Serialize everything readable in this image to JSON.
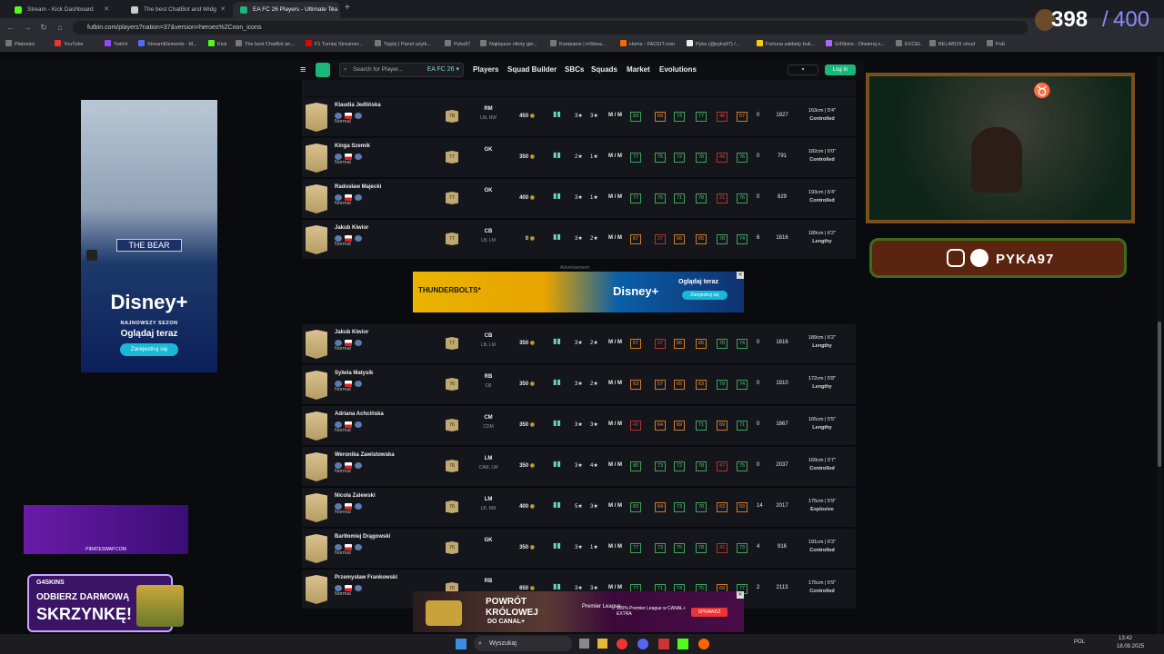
{
  "browser": {
    "tabs": [
      {
        "label": "Stream - Kick Dashboard",
        "color": "#53fc18"
      },
      {
        "label": "The best ChatBot and Widg",
        "color": "#cccccc"
      },
      {
        "label": "EA FC 26 Players - Ultimate Tea",
        "color": "#1ab67a"
      }
    ],
    "url": "futbin.com/players?nation=37&version=heroes%2Cnon_icons",
    "bookmarks": [
      "Płatności",
      "YouTube",
      "Twitch",
      "StreamElements - M...",
      "Kick",
      "The best ChatBot an...",
      "F1 Turniej Streamer...",
      "Tipply | Panel użytk...",
      "Pyka97",
      "Najlepsze oferty gie...",
      "Kampanie | inStrea...",
      "Home - FACEIT.com",
      "Pyka (@pyka97) /...",
      "Fortuna zakłady buk...",
      "G4Skins - Otwieraj s...",
      "EXCEL",
      "BELABOX cloud",
      "PoE"
    ]
  },
  "site": {
    "search_placeholder": "Search for Player...",
    "game_version": "EA FC 26",
    "nav": [
      "Players",
      "Squad Builder",
      "SBCs",
      "Squads",
      "Market",
      "Evolutions"
    ],
    "login": "Log In"
  },
  "ad_label": "Advertisement",
  "players_top": [
    {
      "name": "Klaudia Jedlińska",
      "version": "Normal",
      "rating": "78",
      "pos": "RM",
      "alt": "LM, RW",
      "price": "450",
      "sm": "3★",
      "wf": "3★",
      "wr": "M / M",
      "stats": [
        [
          "83",
          "g"
        ],
        [
          "69",
          "o"
        ],
        [
          "73",
          "g"
        ],
        [
          "77",
          "g"
        ],
        [
          "48",
          "r"
        ],
        [
          "57",
          "o"
        ]
      ],
      "bs": "0",
      "total": "1927",
      "height": "163cm | 5'4\"",
      "body": "Controlled"
    },
    {
      "name": "Kinga Szemik",
      "version": "Normal",
      "rating": "77",
      "pos": "GK",
      "alt": "",
      "price": "350",
      "sm": "2★",
      "wf": "1★",
      "wr": "M / M",
      "stats": [
        [
          "77",
          "g"
        ],
        [
          "75",
          "g"
        ],
        [
          "72",
          "g"
        ],
        [
          "78",
          "g"
        ],
        [
          "49",
          "r"
        ],
        [
          "76",
          "g"
        ]
      ],
      "bs": "0",
      "total": "791",
      "height": "182cm | 6'0\"",
      "body": "Controlled"
    },
    {
      "name": "Radosław Majecki",
      "version": "Normal",
      "rating": "77",
      "pos": "GK",
      "alt": "",
      "price": "400",
      "sm": "3★",
      "wf": "1★",
      "wr": "M / M",
      "stats": [
        [
          "77",
          "g"
        ],
        [
          "75",
          "g"
        ],
        [
          "71",
          "g"
        ],
        [
          "78",
          "g"
        ],
        [
          "31",
          "r"
        ],
        [
          "76",
          "g"
        ]
      ],
      "bs": "0",
      "total": "829",
      "height": "193cm | 6'4\"",
      "body": "Controlled"
    },
    {
      "name": "Jakub Kiwior",
      "version": "Normal",
      "rating": "77",
      "pos": "CB",
      "alt": "LB, LM",
      "price": "0",
      "sm": "3★",
      "wf": "2★",
      "wr": "M / M",
      "stats": [
        [
          "67",
          "o"
        ],
        [
          "37",
          "r"
        ],
        [
          "66",
          "o"
        ],
        [
          "65",
          "o"
        ],
        [
          "78",
          "g"
        ],
        [
          "74",
          "g"
        ]
      ],
      "bs": "6",
      "total": "1816",
      "height": "189cm | 6'2\"",
      "body": "Lengthy"
    }
  ],
  "players_bottom": [
    {
      "name": "Jakub Kiwior",
      "version": "Normal",
      "rating": "77",
      "pos": "CB",
      "alt": "LB, LM",
      "price": "350",
      "sm": "3★",
      "wf": "2★",
      "wr": "M / M",
      "stats": [
        [
          "67",
          "o"
        ],
        [
          "37",
          "r"
        ],
        [
          "66",
          "o"
        ],
        [
          "65",
          "o"
        ],
        [
          "78",
          "g"
        ],
        [
          "74",
          "g"
        ]
      ],
      "bs": "0",
      "total": "1816",
      "height": "189cm | 6'2\"",
      "body": "Lengthy"
    },
    {
      "name": "Sylwia Matysik",
      "version": "Normal",
      "rating": "76",
      "pos": "RB",
      "alt": "CB",
      "price": "350",
      "sm": "3★",
      "wf": "2★",
      "wr": "M / M",
      "stats": [
        [
          "63",
          "o"
        ],
        [
          "57",
          "o"
        ],
        [
          "65",
          "o"
        ],
        [
          "63",
          "o"
        ],
        [
          "79",
          "g"
        ],
        [
          "74",
          "g"
        ]
      ],
      "bs": "0",
      "total": "1910",
      "height": "172cm | 5'8\"",
      "body": "Lengthy"
    },
    {
      "name": "Adriana Achcińska",
      "version": "Normal",
      "rating": "76",
      "pos": "CM",
      "alt": "CDM",
      "price": "350",
      "sm": "3★",
      "wf": "3★",
      "wr": "M / M",
      "stats": [
        [
          "41",
          "r"
        ],
        [
          "64",
          "o"
        ],
        [
          "69",
          "o"
        ],
        [
          "71",
          "g"
        ],
        [
          "69",
          "o"
        ],
        [
          "71",
          "g"
        ]
      ],
      "bs": "0",
      "total": "1867",
      "height": "165cm | 5'5\"",
      "body": "Lengthy"
    },
    {
      "name": "Weronika Zawistowska",
      "version": "Normal",
      "rating": "76",
      "pos": "LM",
      "alt": "CAM, LW",
      "price": "350",
      "sm": "3★",
      "wf": "4★",
      "wr": "M / M",
      "stats": [
        [
          "80",
          "g"
        ],
        [
          "73",
          "g"
        ],
        [
          "72",
          "g"
        ],
        [
          "78",
          "g"
        ],
        [
          "47",
          "r"
        ],
        [
          "75",
          "g"
        ]
      ],
      "bs": "0",
      "total": "2037",
      "height": "169cm | 5'7\"",
      "body": "Controlled"
    },
    {
      "name": "Nicola Zalewski",
      "version": "Normal",
      "rating": "76",
      "pos": "LM",
      "alt": "LB, RM",
      "price": "400",
      "sm": "5★",
      "wf": "3★",
      "wr": "M / M",
      "stats": [
        [
          "83",
          "g"
        ],
        [
          "64",
          "o"
        ],
        [
          "73",
          "g"
        ],
        [
          "78",
          "g"
        ],
        [
          "63",
          "o"
        ],
        [
          "59",
          "o"
        ]
      ],
      "bs": "14",
      "total": "2017",
      "height": "175cm | 5'9\"",
      "body": "Explosive"
    },
    {
      "name": "Bartłomiej Drągowski",
      "version": "Normal",
      "rating": "76",
      "pos": "GK",
      "alt": "",
      "price": "350",
      "sm": "3★",
      "wf": "1★",
      "wr": "M / M",
      "stats": [
        [
          "77",
          "g"
        ],
        [
          "73",
          "g"
        ],
        [
          "75",
          "g"
        ],
        [
          "78",
          "g"
        ],
        [
          "42",
          "r"
        ],
        [
          "73",
          "g"
        ]
      ],
      "bs": "4",
      "total": "916",
      "height": "191cm | 6'3\"",
      "body": "Controlled"
    },
    {
      "name": "Przemysław Frankowski",
      "version": "Normal",
      "rating": "76",
      "pos": "RB",
      "alt": "",
      "price": "650",
      "sm": "3★",
      "wf": "3★",
      "wr": "M / M",
      "stats": [
        [
          "77",
          "g"
        ],
        [
          "71",
          "g"
        ],
        [
          "74",
          "g"
        ],
        [
          "75",
          "g"
        ],
        [
          "69",
          "o"
        ],
        [
          "77",
          "g"
        ]
      ],
      "bs": "2",
      "total": "2113",
      "height": "175cm | 5'9\"",
      "body": "Controlled"
    }
  ],
  "ads": {
    "bear_title": "THE BEAR",
    "bear_brand": "Disney+",
    "bear_line1": "NAJNOWSZY SEZON",
    "bear_line2": "Oglądaj teraz",
    "bear_cta": "Zarejestruj się",
    "thunder_title": "THUNDERBOLTS*",
    "thunder_brand": "Disney+",
    "thunder_line": "Oglądaj teraz",
    "thunder_cta": "Zarejestruj się",
    "pirate_text": "PIRATESWAP.COM",
    "g4_brand": "G4SKINS",
    "g4_line1": "ODBIERZ DARMOWĄ",
    "g4_line2": "SKRZYNKĘ!",
    "canal_line1": "POWRÓT",
    "canal_line2": "KRÓLOWEJ",
    "canal_line3": "DO CANAL+",
    "canal_pl": "Premier League",
    "canal_promo": "100% Premier League w CANAL+ EXTRA",
    "canal_cta": "SPRAWDŹ"
  },
  "stream": {
    "viewers": "398",
    "goal": "400",
    "handle": "PYKA97"
  },
  "taskbar": {
    "search": "Wyszukaj",
    "lang": "POL",
    "time": "13:42",
    "date": "18.09.2025"
  }
}
